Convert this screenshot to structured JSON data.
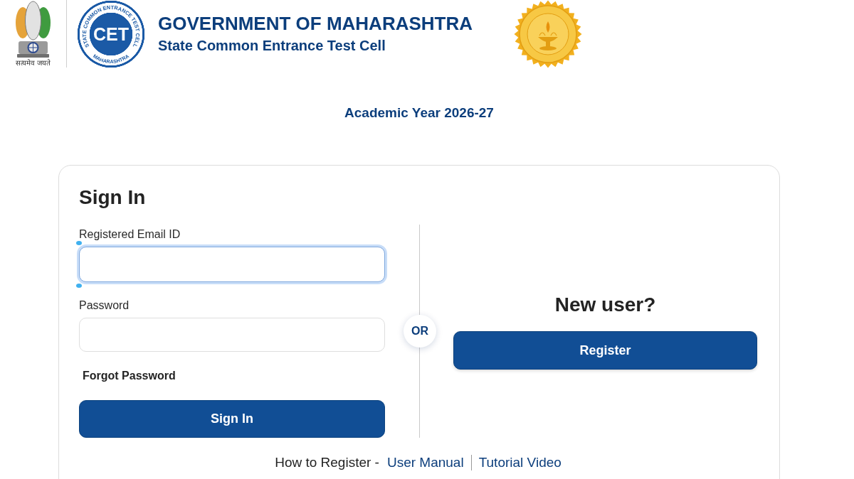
{
  "header": {
    "emblem": {
      "motto": "सत्यमेव जयते"
    },
    "cet_logo": {
      "ring_top": "STATE COMMON ENTRANCE TEST CELL",
      "ring_bottom": "MAHARASHTRA",
      "lettering": "CET"
    },
    "title": "GOVERNMENT OF MAHARASHTRA",
    "subtitle": "State Common Entrance Test Cell"
  },
  "academic_year": "Academic Year 2026-27",
  "sign_in": {
    "heading": "Sign In",
    "fields": [
      {
        "label": "Registered Email ID",
        "focused": true
      },
      {
        "label": "Password",
        "focused": false
      }
    ],
    "forgot_link": "Forgot Password",
    "button": "Sign In"
  },
  "separator": "OR",
  "new_user": {
    "heading": "New user?",
    "button": "Register"
  },
  "help": {
    "label": "How to Register -",
    "links": [
      "User Manual",
      "Tutorial Video"
    ]
  }
}
